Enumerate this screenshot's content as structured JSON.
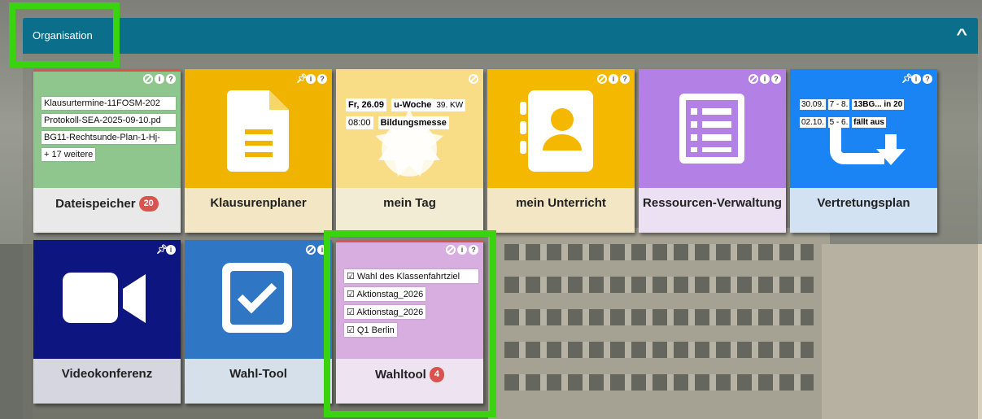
{
  "header": {
    "title": "Organisation",
    "collapse_icon": "chevron-up-icon"
  },
  "tiles": [
    {
      "label": "Dateispeicher",
      "badge": "20",
      "color": "#8fc68e",
      "lines": [
        "Klausurtermine-11FOSM-202",
        "Protokoll-SEA-2025-09-10.pd",
        "BG11-Rechtsunde-Plan-1-Hj-",
        "+ 17 weitere"
      ]
    },
    {
      "label": "Klausurenplaner",
      "color": "#f0b400"
    },
    {
      "label": "mein Tag",
      "color": "#f9dc86",
      "lines": [
        "Fr, 26.09",
        "u-Woche",
        "39. KW",
        "08:00",
        "Bildungsmesse"
      ]
    },
    {
      "label": "mein Unterricht",
      "color": "#f5b800"
    },
    {
      "label": "Ressourcen-Verwaltung",
      "color": "#b380e6"
    },
    {
      "label": "Vertretungsplan",
      "color": "#1a84f5",
      "rows": [
        [
          "30.09.",
          "7 - 8.",
          "13BG... in 20"
        ],
        [
          "02.10.",
          "5 - 6.",
          "fällt aus"
        ]
      ]
    },
    {
      "label": "Videokonferenz",
      "color": "#0c1580"
    },
    {
      "label": "Wahl-Tool",
      "color": "#2f76c4"
    },
    {
      "label": "Wahltool",
      "badge": "4",
      "color": "#d8aee0",
      "lines": [
        "Wahl des Klassenfahrtziel",
        "Aktionstag_2026",
        "Aktionstag_2026",
        "Q1 Berlin"
      ]
    }
  ]
}
